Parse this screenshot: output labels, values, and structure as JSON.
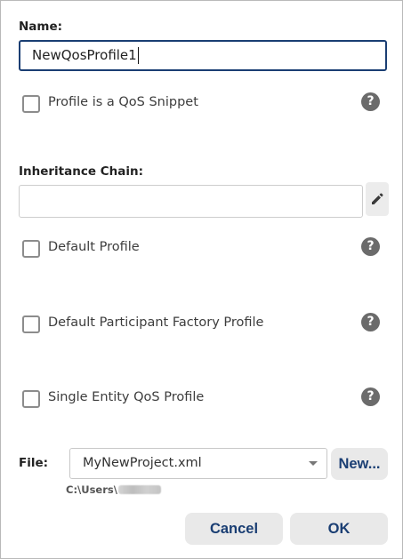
{
  "name": {
    "label": "Name:",
    "value": "NewQosProfile1"
  },
  "options": {
    "qos_snippet": {
      "label": "Profile is a QoS Snippet",
      "checked": false,
      "help_icon": "question-circle"
    },
    "default_profile": {
      "label": "Default Profile",
      "checked": false,
      "help_icon": "question-circle"
    },
    "default_participant_factory": {
      "label": "Default Participant Factory Profile",
      "checked": false,
      "help_icon": "question-circle"
    },
    "single_entity": {
      "label": "Single Entity QoS Profile",
      "checked": false,
      "help_icon": "question-circle"
    }
  },
  "inheritance": {
    "label": "Inheritance Chain:",
    "value": "",
    "edit_icon": "pencil"
  },
  "help_glyph": "?",
  "file": {
    "label": "File:",
    "selected": "MyNewProject.xml",
    "new_label": "New...",
    "path_prefix": "C:\\Users\\"
  },
  "actions": {
    "cancel_label": "Cancel",
    "ok_label": "OK"
  },
  "colors": {
    "accent": "#1a3e73",
    "help_icon_bg": "#6b6b6b",
    "button_bg": "#e9e9e9"
  }
}
